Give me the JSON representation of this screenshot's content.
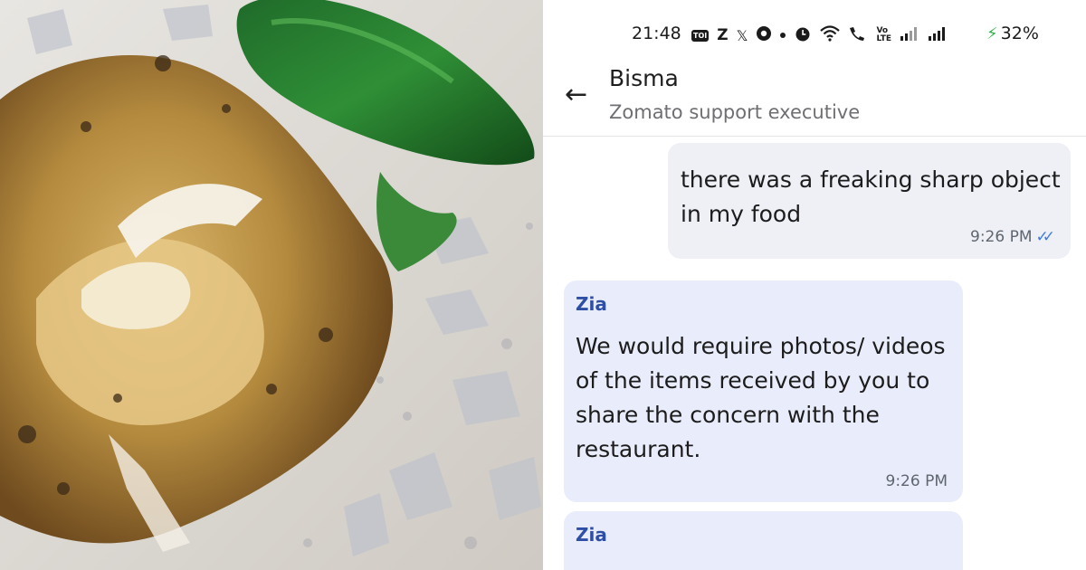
{
  "photo": {
    "subject": "fried food item with a green chilli and a sharp piece of plastic"
  },
  "status_bar": {
    "time": "21:48",
    "icons": [
      "toi-icon",
      "z-icon",
      "x-icon",
      "chrome-icon",
      "dot-icon",
      "alarm-icon",
      "wifi-icon",
      "wifi-call-icon",
      "volte-icon",
      "signal-icon",
      "signal-icon",
      "charging-icon"
    ],
    "toi_label": "TOI",
    "z_label": "Z",
    "x_label": "𝕏",
    "volte_label": "Vo\nLTE",
    "battery": "32%"
  },
  "header": {
    "contact_name": "Bisma",
    "contact_subtitle": "Zomato support executive"
  },
  "messages": [
    {
      "direction": "outgoing",
      "text": "there was a freaking sharp object in my food",
      "time": "9:26 PM",
      "status": "read"
    },
    {
      "direction": "incoming",
      "sender": "Zia",
      "text": "We would require photos/ videos of the items received by you to share the concern with the restaurant.",
      "time": "9:26 PM"
    },
    {
      "direction": "incoming",
      "sender": "Zia",
      "text": ""
    }
  ],
  "colors": {
    "outgoing_bubble": "#eef0f6",
    "incoming_bubble": "#e9edfb",
    "sender_name": "#2d4fa5",
    "read_ticks": "#3f7be0",
    "charging": "#2fb34a"
  }
}
